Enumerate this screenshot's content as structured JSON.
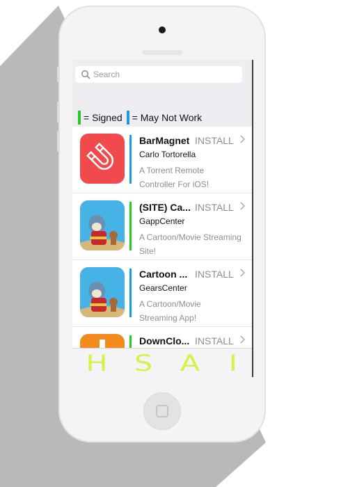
{
  "search": {
    "placeholder": "Search"
  },
  "legend": {
    "signed_label": "= Signed",
    "may_not_work_label": "= May Not Work",
    "signed_color": "#22cc22",
    "may_not_work_color": "#1a9de0"
  },
  "apps": [
    {
      "title": "BarMagnet",
      "install": "INSTALL",
      "developer": "Carlo Tortorella",
      "desc1": "A Torrent Remote",
      "desc2": "Controller For iOS!",
      "status": "may_not_work",
      "icon": "magnet-icon"
    },
    {
      "title": "(SITE) Ca...",
      "install": "INSTALL",
      "developer": "GappCenter",
      "desc1": "A Cartoon/Movie Streaming",
      "desc2": "Site!",
      "status": "signed",
      "icon": "cartoon-icon"
    },
    {
      "title": "Cartoon ...",
      "install": "INSTALL",
      "developer": "GearsCenter",
      "desc1": "A Cartoon/Movie",
      "desc2": "Streaming App!",
      "status": "may_not_work",
      "icon": "cartoon-icon"
    },
    {
      "title": "DownClo...",
      "install": "INSTALL",
      "developer": "",
      "desc1": "",
      "desc2": "",
      "status": "signed",
      "icon": "download-icon"
    }
  ],
  "tabbar": {
    "tabs": [
      "H",
      "S",
      "A",
      "I"
    ]
  }
}
